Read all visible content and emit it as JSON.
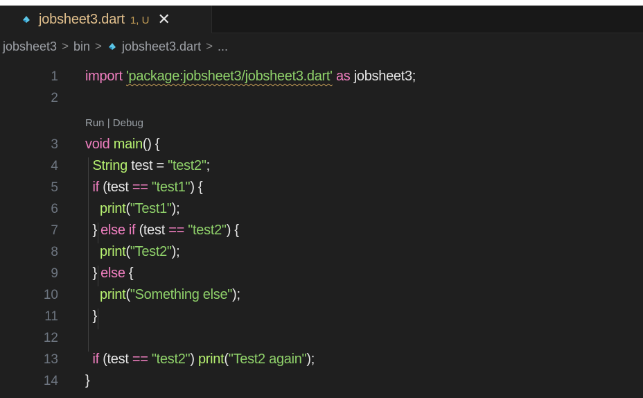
{
  "tab": {
    "filename": "jobsheet3.dart",
    "status": "1, U",
    "close_glyph": "✕"
  },
  "breadcrumb": {
    "items": [
      "jobsheet3",
      "bin",
      "jobsheet3.dart",
      "..."
    ],
    "separator": ">"
  },
  "codelens": {
    "run": "Run",
    "divider": "|",
    "debug": "Debug"
  },
  "lines": [
    {
      "n": "1",
      "parts": [
        {
          "t": "import ",
          "c": "kw-pink"
        },
        {
          "t": "'package:jobsheet3/jobsheet3.dart'",
          "c": "str squiggle"
        },
        {
          "t": " as ",
          "c": "kw-pink"
        },
        {
          "t": "jobsheet3;",
          "c": ""
        }
      ]
    },
    {
      "n": "2",
      "parts": []
    },
    {
      "n": "3",
      "parts": [
        {
          "t": "void ",
          "c": "kw-pink"
        },
        {
          "t": "main",
          "c": "fn-green"
        },
        {
          "t": "() {",
          "c": ""
        }
      ]
    },
    {
      "n": "4",
      "parts": [
        {
          "t": "  ",
          "c": ""
        },
        {
          "t": "String ",
          "c": "fn-green"
        },
        {
          "t": "test = ",
          "c": ""
        },
        {
          "t": "\"test2\"",
          "c": "str"
        },
        {
          "t": ";",
          "c": ""
        }
      ]
    },
    {
      "n": "5",
      "parts": [
        {
          "t": "  ",
          "c": ""
        },
        {
          "t": "if ",
          "c": "kw-pink"
        },
        {
          "t": "(test ",
          "c": ""
        },
        {
          "t": "==",
          "c": "op-pink"
        },
        {
          "t": " ",
          "c": ""
        },
        {
          "t": "\"test1\"",
          "c": "str"
        },
        {
          "t": ") {",
          "c": ""
        }
      ]
    },
    {
      "n": "6",
      "parts": [
        {
          "t": "    ",
          "c": ""
        },
        {
          "t": "print",
          "c": "fn-green"
        },
        {
          "t": "(",
          "c": ""
        },
        {
          "t": "\"Test1\"",
          "c": "str"
        },
        {
          "t": ");",
          "c": ""
        }
      ]
    },
    {
      "n": "7",
      "parts": [
        {
          "t": "  } ",
          "c": ""
        },
        {
          "t": "else if ",
          "c": "kw-pink"
        },
        {
          "t": "(test ",
          "c": ""
        },
        {
          "t": "==",
          "c": "op-pink"
        },
        {
          "t": " ",
          "c": ""
        },
        {
          "t": "\"test2\"",
          "c": "str"
        },
        {
          "t": ") {",
          "c": ""
        }
      ]
    },
    {
      "n": "8",
      "parts": [
        {
          "t": "    ",
          "c": ""
        },
        {
          "t": "print",
          "c": "fn-green"
        },
        {
          "t": "(",
          "c": ""
        },
        {
          "t": "\"Test2\"",
          "c": "str"
        },
        {
          "t": ");",
          "c": ""
        }
      ]
    },
    {
      "n": "9",
      "parts": [
        {
          "t": "  } ",
          "c": ""
        },
        {
          "t": "else ",
          "c": "kw-pink"
        },
        {
          "t": "{",
          "c": ""
        }
      ]
    },
    {
      "n": "10",
      "parts": [
        {
          "t": "    ",
          "c": ""
        },
        {
          "t": "print",
          "c": "fn-green"
        },
        {
          "t": "(",
          "c": ""
        },
        {
          "t": "\"Something else\"",
          "c": "str"
        },
        {
          "t": ");",
          "c": ""
        }
      ]
    },
    {
      "n": "11",
      "parts": [
        {
          "t": "  }",
          "c": ""
        }
      ]
    },
    {
      "n": "12",
      "parts": []
    },
    {
      "n": "13",
      "parts": [
        {
          "t": "  ",
          "c": ""
        },
        {
          "t": "if ",
          "c": "kw-pink"
        },
        {
          "t": "(test ",
          "c": ""
        },
        {
          "t": "==",
          "c": "op-pink"
        },
        {
          "t": " ",
          "c": ""
        },
        {
          "t": "\"test2\"",
          "c": "str"
        },
        {
          "t": ") ",
          "c": ""
        },
        {
          "t": "print",
          "c": "fn-green"
        },
        {
          "t": "(",
          "c": ""
        },
        {
          "t": "\"Test2 again\"",
          "c": "str"
        },
        {
          "t": ");",
          "c": ""
        }
      ]
    },
    {
      "n": "14",
      "parts": [
        {
          "t": "}",
          "c": ""
        }
      ]
    }
  ],
  "colors": {
    "background": "#1f1f1f",
    "tab_modified": "#e2c08d",
    "keyword": "#f07fc0",
    "string": "#8fd16a",
    "line_number": "#6e7681"
  },
  "icons": {
    "tab_file": "dart-file-icon",
    "breadcrumb_file": "dart-file-icon",
    "tab_close": "close-icon"
  }
}
